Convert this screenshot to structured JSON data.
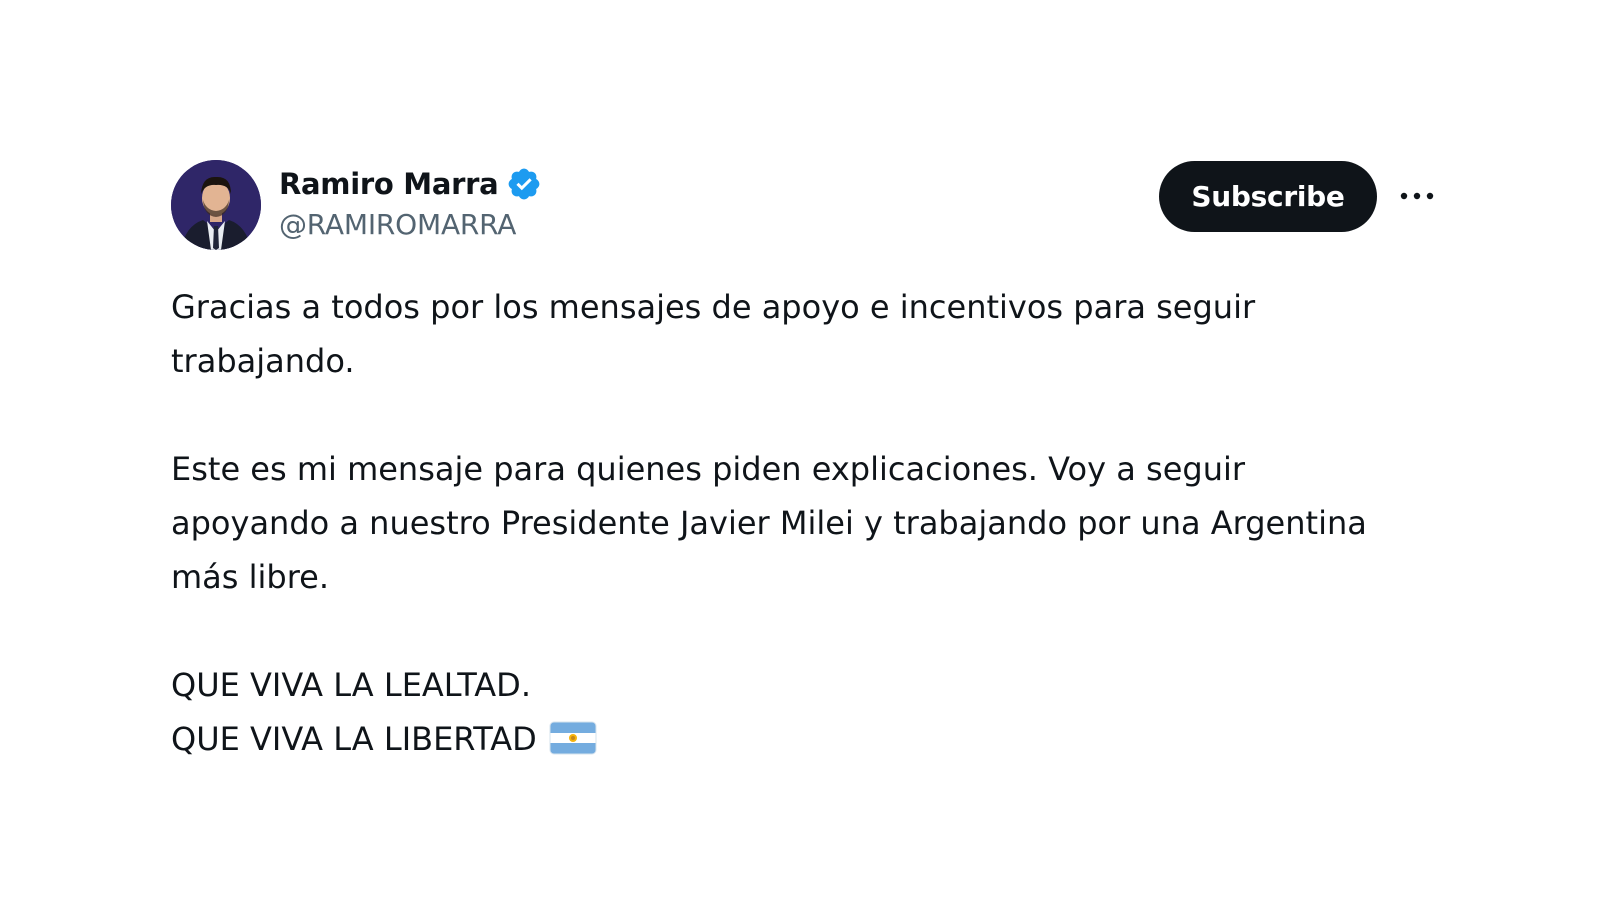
{
  "tweet": {
    "author": {
      "display_name": "Ramiro Marra",
      "handle": "@RAMIROMARRA",
      "verified_icon": "verified-badge-icon",
      "avatar": "author-avatar"
    },
    "subscribe_label": "Subscribe",
    "more_icon": "more-options-icon",
    "paragraphs": [
      [
        "Gracias a todos por los mensajes de apoyo e incentivos para seguir",
        "trabajando."
      ],
      [
        "Este es mi mensaje para quienes piden explicaciones. Voy a seguir",
        "apoyando a nuestro Presidente Javier Milei y trabajando por una Argentina",
        "más libre."
      ],
      [
        "QUE VIVA LA LEALTAD.",
        "QUE VIVA LA LIBERTAD"
      ]
    ],
    "flag_icon": "argentina-flag-icon"
  },
  "colors": {
    "text": "#0f1419",
    "secondary_text": "#536471",
    "verified_blue": "#1d9bf0",
    "button_bg": "#0f1419",
    "button_text": "#ffffff",
    "flag_blue": "#74acdf"
  }
}
